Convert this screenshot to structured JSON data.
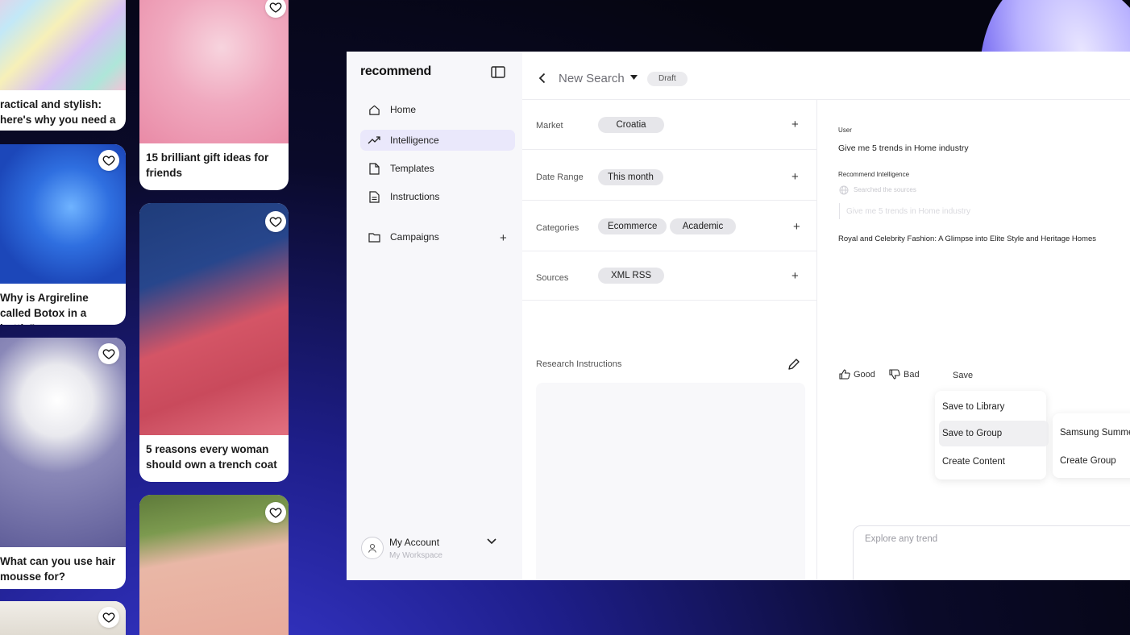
{
  "feed": {
    "pins": [
      {
        "caption": "ractical and stylish: here's why you need a belt bag"
      },
      {
        "caption": "15 brilliant gift ideas for friends"
      },
      {
        "caption": "Why is Argireline called Botox in a bottle\""
      },
      {
        "caption": "5 reasons every woman should own a trench coat"
      },
      {
        "caption": "What can you use hair mousse for?"
      }
    ]
  },
  "app": {
    "logo": "recommend",
    "nav": {
      "home": "Home",
      "intelligence": "Intelligence",
      "templates": "Templates",
      "instructions": "Instructions",
      "campaigns": "Campaigns",
      "plus": "+"
    },
    "account": {
      "name": "My Account",
      "workspace": "My Workspace"
    },
    "header": {
      "title": "New Search",
      "status": "Draft"
    },
    "filters": {
      "market": {
        "label": "Market",
        "chips": [
          "Croatia"
        ]
      },
      "date_range": {
        "label": "Date Range",
        "chips": [
          "This month"
        ]
      },
      "categories": {
        "label": "Categories",
        "chips": [
          "Ecommerce",
          "Academic"
        ]
      },
      "sources": {
        "label": "Sources",
        "chips": [
          "XML RSS"
        ]
      },
      "plus": "+",
      "research_label": "Research Instructions"
    },
    "chat": {
      "user_role": "User",
      "user_message": "Give me 5 trends in Home industry",
      "ai_role": "Recommend Intelligence",
      "searched": "Searched the sources",
      "quoted": "Give me 5 trends in Home industry",
      "answer": "Royal and Celebrity Fashion: A Glimpse into Elite Style and Heritage Homes",
      "actions": {
        "good": "Good",
        "bad": "Bad",
        "save": "Save"
      },
      "save_menu": [
        "Save to Library",
        "Save to  Group",
        "Create Content"
      ],
      "group_menu": [
        "Samsung Summe",
        "Create Group"
      ],
      "input_placeholder": "Explore any trend"
    }
  }
}
